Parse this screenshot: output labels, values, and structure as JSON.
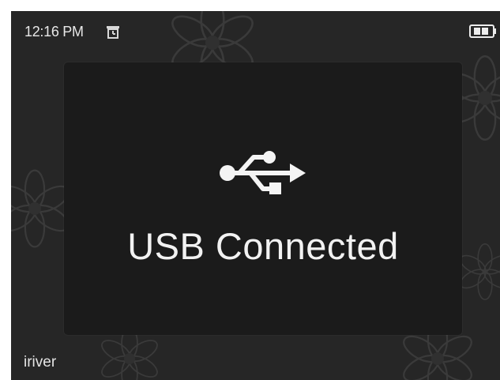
{
  "status_bar": {
    "time": "12:16 PM",
    "alarm_icon": "alarm-clock-icon",
    "battery_icon": "battery-icon"
  },
  "dialog": {
    "icon": "usb-icon",
    "message": "USB Connected"
  },
  "footer": {
    "brand": "iriver"
  },
  "colors": {
    "screen_background": "#262626",
    "dialog_background": "#1b1b1b",
    "text": "#f2f2f2"
  }
}
